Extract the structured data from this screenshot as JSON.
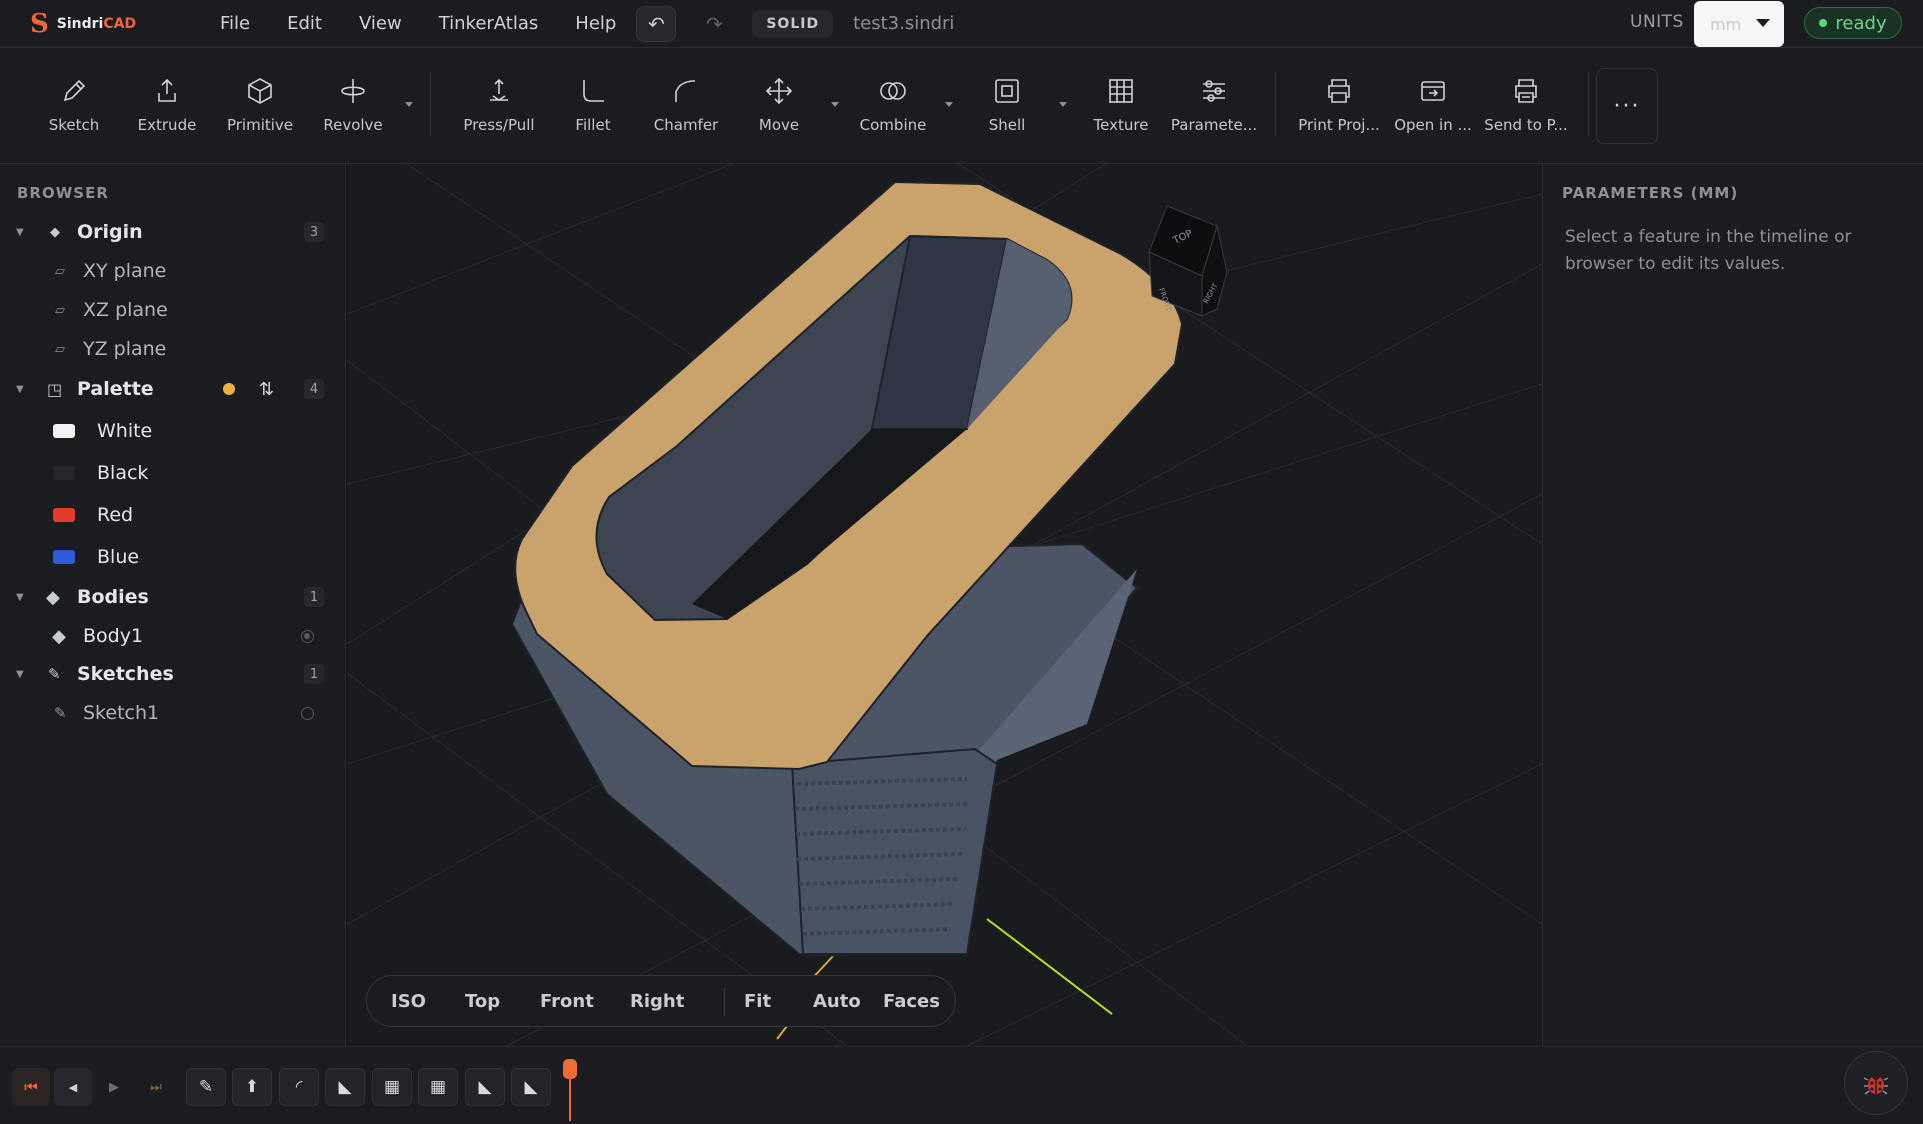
{
  "app": {
    "brand_logo": "S",
    "brand_prefix": "Sindri",
    "brand_suffix": "CAD"
  },
  "menu": [
    "File",
    "Edit",
    "View",
    "TinkerAtlas",
    "Help"
  ],
  "header": {
    "undo_icon": "↶",
    "redo_icon": "↷",
    "mode": "SOLID",
    "filename": "test3.sindri",
    "units_label": "UNITS",
    "units_value": "mm",
    "status": "ready"
  },
  "toolbar": {
    "tools": [
      {
        "label": "Sketch",
        "icon": "pencil-icon"
      },
      {
        "label": "Extrude",
        "icon": "extrude-icon"
      },
      {
        "label": "Primitive",
        "icon": "cube-icon"
      },
      {
        "label": "Revolve",
        "icon": "revolve-icon"
      },
      {
        "label": "Press/Pull",
        "icon": "press-pull-icon"
      },
      {
        "label": "Fillet",
        "icon": "fillet-icon"
      },
      {
        "label": "Chamfer",
        "icon": "chamfer-icon"
      },
      {
        "label": "Move",
        "icon": "move-icon"
      },
      {
        "label": "Combine",
        "icon": "combine-icon"
      },
      {
        "label": "Shell",
        "icon": "shell-icon"
      },
      {
        "label": "Texture",
        "icon": "texture-icon"
      },
      {
        "label": "Paramete...",
        "icon": "sliders-icon"
      },
      {
        "label": "Print Proj...",
        "icon": "printer-icon"
      },
      {
        "label": "Open in ...",
        "icon": "open-in-icon"
      },
      {
        "label": "Send to P...",
        "icon": "send-printer-icon"
      }
    ],
    "more_label": "···"
  },
  "browser": {
    "title": "BROWSER",
    "origin": {
      "label": "Origin",
      "count": "3",
      "items": [
        "XY plane",
        "XZ plane",
        "YZ plane"
      ]
    },
    "palette": {
      "label": "Palette",
      "count": "4",
      "colors": [
        {
          "label": "White",
          "color": "#f2f2f2"
        },
        {
          "label": "Black",
          "color": "#26272a"
        },
        {
          "label": "Red",
          "color": "#e23b2e"
        },
        {
          "label": "Blue",
          "color": "#2f5bd8"
        }
      ]
    },
    "bodies": {
      "label": "Bodies",
      "count": "1",
      "items": [
        "Body1"
      ]
    },
    "sketches": {
      "label": "Sketches",
      "count": "1",
      "items": [
        "Sketch1"
      ]
    }
  },
  "viewport": {
    "view_buttons": [
      "ISO",
      "Top",
      "Front",
      "Right",
      "Fit",
      "Auto",
      "Faces"
    ],
    "cube_faces": {
      "top": "TOP",
      "front": "FRONT",
      "right": "RIGHT"
    }
  },
  "parameters": {
    "title": "PARAMETERS (MM)",
    "hint": "Select a feature in the timeline or browser to edit its values."
  },
  "timeline": {
    "controls": [
      "⏮",
      "◀",
      "▶",
      "⏭"
    ],
    "features": [
      "✎",
      "⬆",
      "◜",
      "◣",
      "▦",
      "▦",
      "◣",
      "◣"
    ]
  },
  "colors": {
    "accent": "#f06a35",
    "status_green": "#5cd67c",
    "palette_dot": "#e6b43c",
    "model_top": "#c9a26c",
    "model_side": "#4c5566"
  }
}
